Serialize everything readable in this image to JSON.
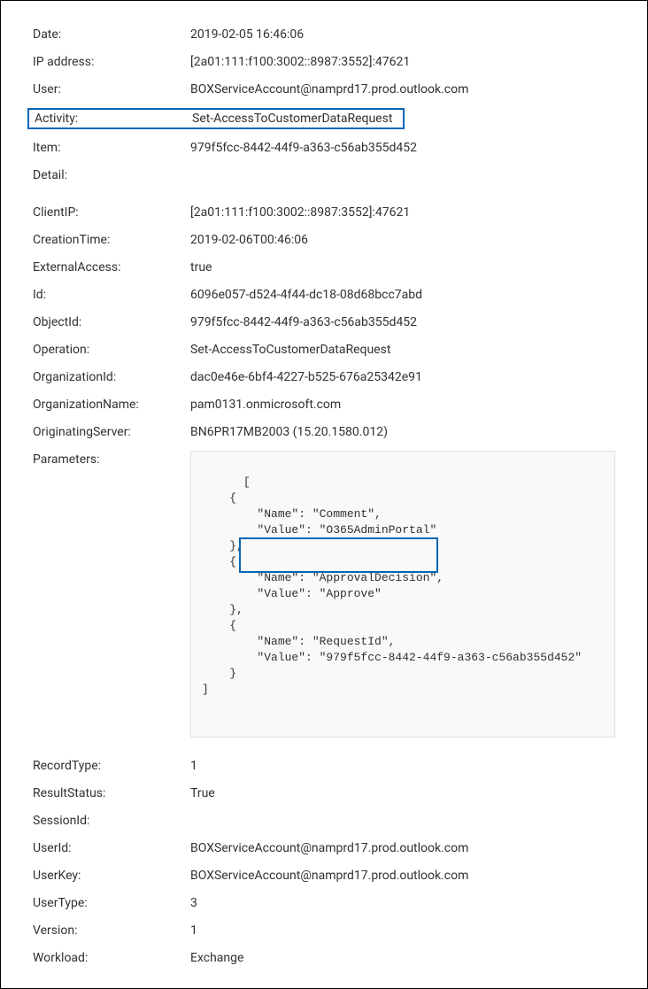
{
  "summary": {
    "date": {
      "label": "Date:",
      "value": "2019-02-05 16:46:06"
    },
    "ip_address": {
      "label": "IP address:",
      "value": "[2a01:111:f100:3002::8987:3552]:47621"
    },
    "user": {
      "label": "User:",
      "value": "BOXServiceAccount@namprd17.prod.outlook.com"
    },
    "activity": {
      "label": "Activity:",
      "value": "Set-AccessToCustomerDataRequest"
    },
    "item": {
      "label": "Item:",
      "value": "979f5fcc-8442-44f9-a363-c56ab355d452"
    },
    "detail": {
      "label": "Detail:",
      "value": ""
    }
  },
  "details": {
    "client_ip": {
      "label": "ClientIP:",
      "value": "[2a01:111:f100:3002::8987:3552]:47621"
    },
    "creation_time": {
      "label": "CreationTime:",
      "value": "2019-02-06T00:46:06"
    },
    "external_access": {
      "label": "ExternalAccess:",
      "value": "true"
    },
    "id": {
      "label": "Id:",
      "value": "6096e057-d524-4f44-dc18-08d68bcc7abd"
    },
    "object_id": {
      "label": "ObjectId:",
      "value": "979f5fcc-8442-44f9-a363-c56ab355d452"
    },
    "operation": {
      "label": "Operation:",
      "value": "Set-AccessToCustomerDataRequest"
    },
    "organization_id": {
      "label": "OrganizationId:",
      "value": "dac0e46e-6bf4-4227-b525-676a25342e91"
    },
    "organization_name": {
      "label": "OrganizationName:",
      "value": "pam0131.onmicrosoft.com"
    },
    "originating_server": {
      "label": "OriginatingServer:",
      "value": "BN6PR17MB2003 (15.20.1580.012)"
    },
    "parameters": {
      "label": "Parameters:",
      "raw": "[\n    {\n        \"Name\": \"Comment\",\n        \"Value\": \"O365AdminPortal\"\n    },\n    {\n        \"Name\": \"ApprovalDecision\",\n        \"Value\": \"Approve\"\n    },\n    {\n        \"Name\": \"RequestId\",\n        \"Value\": \"979f5fcc-8442-44f9-a363-c56ab355d452\"\n    }\n]",
      "items": [
        {
          "Name": "Comment",
          "Value": "O365AdminPortal"
        },
        {
          "Name": "ApprovalDecision",
          "Value": "Approve"
        },
        {
          "Name": "RequestId",
          "Value": "979f5fcc-8442-44f9-a363-c56ab355d452"
        }
      ]
    },
    "record_type": {
      "label": "RecordType:",
      "value": "1"
    },
    "result_status": {
      "label": "ResultStatus:",
      "value": "True"
    },
    "session_id": {
      "label": "SessionId:",
      "value": ""
    },
    "user_id": {
      "label": "UserId:",
      "value": "BOXServiceAccount@namprd17.prod.outlook.com"
    },
    "user_key": {
      "label": "UserKey:",
      "value": "BOXServiceAccount@namprd17.prod.outlook.com"
    },
    "user_type": {
      "label": "UserType:",
      "value": "3"
    },
    "version": {
      "label": "Version:",
      "value": "1"
    },
    "workload": {
      "label": "Workload:",
      "value": "Exchange"
    }
  }
}
